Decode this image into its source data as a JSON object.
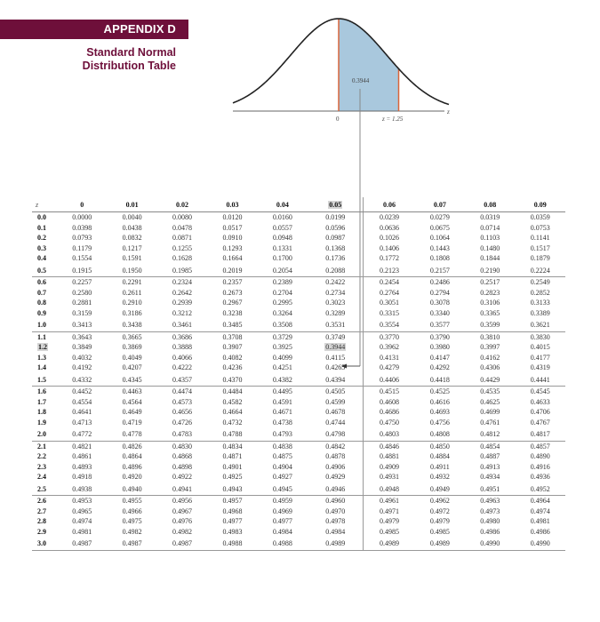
{
  "header": {
    "appendix_label": "APPENDIX D",
    "title_line1": "Standard Normal",
    "title_line2": "Distribution Table"
  },
  "figure": {
    "shaded_area_label": "0.3944",
    "zero_label": "0",
    "z_value_label": "z = 1.25",
    "axis_label": "z",
    "shade_color": "#a9c8dd",
    "boundary_color": "#d9643a",
    "curve_color": "#222222"
  },
  "table": {
    "z_header": "z",
    "columns": [
      "0",
      "0.01",
      "0.02",
      "0.03",
      "0.04",
      "0.05",
      "0.06",
      "0.07",
      "0.08",
      "0.09"
    ],
    "highlight": {
      "row": "1.2",
      "column": "0.05",
      "value": "0.3944"
    },
    "rows": [
      {
        "z": "0.0",
        "v": [
          "0.0000",
          "0.0040",
          "0.0080",
          "0.0120",
          "0.0160",
          "0.0199",
          "0.0239",
          "0.0279",
          "0.0319",
          "0.0359"
        ]
      },
      {
        "z": "0.1",
        "v": [
          "0.0398",
          "0.0438",
          "0.0478",
          "0.0517",
          "0.0557",
          "0.0596",
          "0.0636",
          "0.0675",
          "0.0714",
          "0.0753"
        ]
      },
      {
        "z": "0.2",
        "v": [
          "0.0793",
          "0.0832",
          "0.0871",
          "0.0910",
          "0.0948",
          "0.0987",
          "0.1026",
          "0.1064",
          "0.1103",
          "0.1141"
        ]
      },
      {
        "z": "0.3",
        "v": [
          "0.1179",
          "0.1217",
          "0.1255",
          "0.1293",
          "0.1331",
          "0.1368",
          "0.1406",
          "0.1443",
          "0.1480",
          "0.1517"
        ]
      },
      {
        "z": "0.4",
        "v": [
          "0.1554",
          "0.1591",
          "0.1628",
          "0.1664",
          "0.1700",
          "0.1736",
          "0.1772",
          "0.1808",
          "0.1844",
          "0.1879"
        ]
      },
      {
        "z": "0.5",
        "v": [
          "0.1915",
          "0.1950",
          "0.1985",
          "0.2019",
          "0.2054",
          "0.2088",
          "0.2123",
          "0.2157",
          "0.2190",
          "0.2224"
        ]
      },
      {
        "z": "0.6",
        "v": [
          "0.2257",
          "0.2291",
          "0.2324",
          "0.2357",
          "0.2389",
          "0.2422",
          "0.2454",
          "0.2486",
          "0.2517",
          "0.2549"
        ]
      },
      {
        "z": "0.7",
        "v": [
          "0.2580",
          "0.2611",
          "0.2642",
          "0.2673",
          "0.2704",
          "0.2734",
          "0.2764",
          "0.2794",
          "0.2823",
          "0.2852"
        ]
      },
      {
        "z": "0.8",
        "v": [
          "0.2881",
          "0.2910",
          "0.2939",
          "0.2967",
          "0.2995",
          "0.3023",
          "0.3051",
          "0.3078",
          "0.3106",
          "0.3133"
        ]
      },
      {
        "z": "0.9",
        "v": [
          "0.3159",
          "0.3186",
          "0.3212",
          "0.3238",
          "0.3264",
          "0.3289",
          "0.3315",
          "0.3340",
          "0.3365",
          "0.3389"
        ]
      },
      {
        "z": "1.0",
        "v": [
          "0.3413",
          "0.3438",
          "0.3461",
          "0.3485",
          "0.3508",
          "0.3531",
          "0.3554",
          "0.3577",
          "0.3599",
          "0.3621"
        ]
      },
      {
        "z": "1.1",
        "v": [
          "0.3643",
          "0.3665",
          "0.3686",
          "0.3708",
          "0.3729",
          "0.3749",
          "0.3770",
          "0.3790",
          "0.3810",
          "0.3830"
        ]
      },
      {
        "z": "1.2",
        "v": [
          "0.3849",
          "0.3869",
          "0.3888",
          "0.3907",
          "0.3925",
          "0.3944",
          "0.3962",
          "0.3980",
          "0.3997",
          "0.4015"
        ]
      },
      {
        "z": "1.3",
        "v": [
          "0.4032",
          "0.4049",
          "0.4066",
          "0.4082",
          "0.4099",
          "0.4115",
          "0.4131",
          "0.4147",
          "0.4162",
          "0.4177"
        ]
      },
      {
        "z": "1.4",
        "v": [
          "0.4192",
          "0.4207",
          "0.4222",
          "0.4236",
          "0.4251",
          "0.4265",
          "0.4279",
          "0.4292",
          "0.4306",
          "0.4319"
        ]
      },
      {
        "z": "1.5",
        "v": [
          "0.4332",
          "0.4345",
          "0.4357",
          "0.4370",
          "0.4382",
          "0.4394",
          "0.4406",
          "0.4418",
          "0.4429",
          "0.4441"
        ]
      },
      {
        "z": "1.6",
        "v": [
          "0.4452",
          "0.4463",
          "0.4474",
          "0.4484",
          "0.4495",
          "0.4505",
          "0.4515",
          "0.4525",
          "0.4535",
          "0.4545"
        ]
      },
      {
        "z": "1.7",
        "v": [
          "0.4554",
          "0.4564",
          "0.4573",
          "0.4582",
          "0.4591",
          "0.4599",
          "0.4608",
          "0.4616",
          "0.4625",
          "0.4633"
        ]
      },
      {
        "z": "1.8",
        "v": [
          "0.4641",
          "0.4649",
          "0.4656",
          "0.4664",
          "0.4671",
          "0.4678",
          "0.4686",
          "0.4693",
          "0.4699",
          "0.4706"
        ]
      },
      {
        "z": "1.9",
        "v": [
          "0.4713",
          "0.4719",
          "0.4726",
          "0.4732",
          "0.4738",
          "0.4744",
          "0.4750",
          "0.4756",
          "0.4761",
          "0.4767"
        ]
      },
      {
        "z": "2.0",
        "v": [
          "0.4772",
          "0.4778",
          "0.4783",
          "0.4788",
          "0.4793",
          "0.4798",
          "0.4803",
          "0.4808",
          "0.4812",
          "0.4817"
        ]
      },
      {
        "z": "2.1",
        "v": [
          "0.4821",
          "0.4826",
          "0.4830",
          "0.4834",
          "0.4838",
          "0.4842",
          "0.4846",
          "0.4850",
          "0.4854",
          "0.4857"
        ]
      },
      {
        "z": "2.2",
        "v": [
          "0.4861",
          "0.4864",
          "0.4868",
          "0.4871",
          "0.4875",
          "0.4878",
          "0.4881",
          "0.4884",
          "0.4887",
          "0.4890"
        ]
      },
      {
        "z": "2.3",
        "v": [
          "0.4893",
          "0.4896",
          "0.4898",
          "0.4901",
          "0.4904",
          "0.4906",
          "0.4909",
          "0.4911",
          "0.4913",
          "0.4916"
        ]
      },
      {
        "z": "2.4",
        "v": [
          "0.4918",
          "0.4920",
          "0.4922",
          "0.4925",
          "0.4927",
          "0.4929",
          "0.4931",
          "0.4932",
          "0.4934",
          "0.4936"
        ]
      },
      {
        "z": "2.5",
        "v": [
          "0.4938",
          "0.4940",
          "0.4941",
          "0.4943",
          "0.4945",
          "0.4946",
          "0.4948",
          "0.4949",
          "0.4951",
          "0.4952"
        ]
      },
      {
        "z": "2.6",
        "v": [
          "0.4953",
          "0.4955",
          "0.4956",
          "0.4957",
          "0.4959",
          "0.4960",
          "0.4961",
          "0.4962",
          "0.4963",
          "0.4964"
        ]
      },
      {
        "z": "2.7",
        "v": [
          "0.4965",
          "0.4966",
          "0.4967",
          "0.4968",
          "0.4969",
          "0.4970",
          "0.4971",
          "0.4972",
          "0.4973",
          "0.4974"
        ]
      },
      {
        "z": "2.8",
        "v": [
          "0.4974",
          "0.4975",
          "0.4976",
          "0.4977",
          "0.4977",
          "0.4978",
          "0.4979",
          "0.4979",
          "0.4980",
          "0.4981"
        ]
      },
      {
        "z": "2.9",
        "v": [
          "0.4981",
          "0.4982",
          "0.4982",
          "0.4983",
          "0.4984",
          "0.4984",
          "0.4985",
          "0.4985",
          "0.4986",
          "0.4986"
        ]
      },
      {
        "z": "3.0",
        "v": [
          "0.4987",
          "0.4987",
          "0.4987",
          "0.4988",
          "0.4988",
          "0.4989",
          "0.4989",
          "0.4989",
          "0.4990",
          "0.4990"
        ]
      }
    ]
  }
}
